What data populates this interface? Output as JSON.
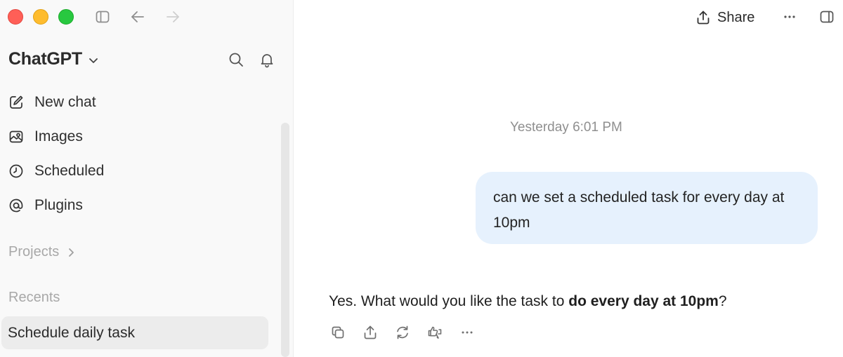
{
  "sidebar": {
    "brand": "ChatGPT",
    "nav": [
      {
        "label": "New chat",
        "icon": "new-chat-icon"
      },
      {
        "label": "Images",
        "icon": "images-icon"
      },
      {
        "label": "Scheduled",
        "icon": "clock-icon"
      },
      {
        "label": "Plugins",
        "icon": "at-sign-icon"
      }
    ],
    "projects_label": "Projects",
    "recents_label": "Recents",
    "recents": [
      "Schedule daily task"
    ]
  },
  "header": {
    "share_label": "Share"
  },
  "conversation": {
    "timestamp": "Yesterday 6:01 PM",
    "user_message": "can we set a scheduled task for every day at 10pm",
    "assistant_prefix": "Yes. What would you like the task to ",
    "assistant_bold": "do every day at 10pm",
    "assistant_suffix": "?"
  },
  "colors": {
    "user_bubble": "#e6f1fd",
    "sidebar_bg": "#f9f9f9",
    "selected_recent": "#ececec"
  }
}
